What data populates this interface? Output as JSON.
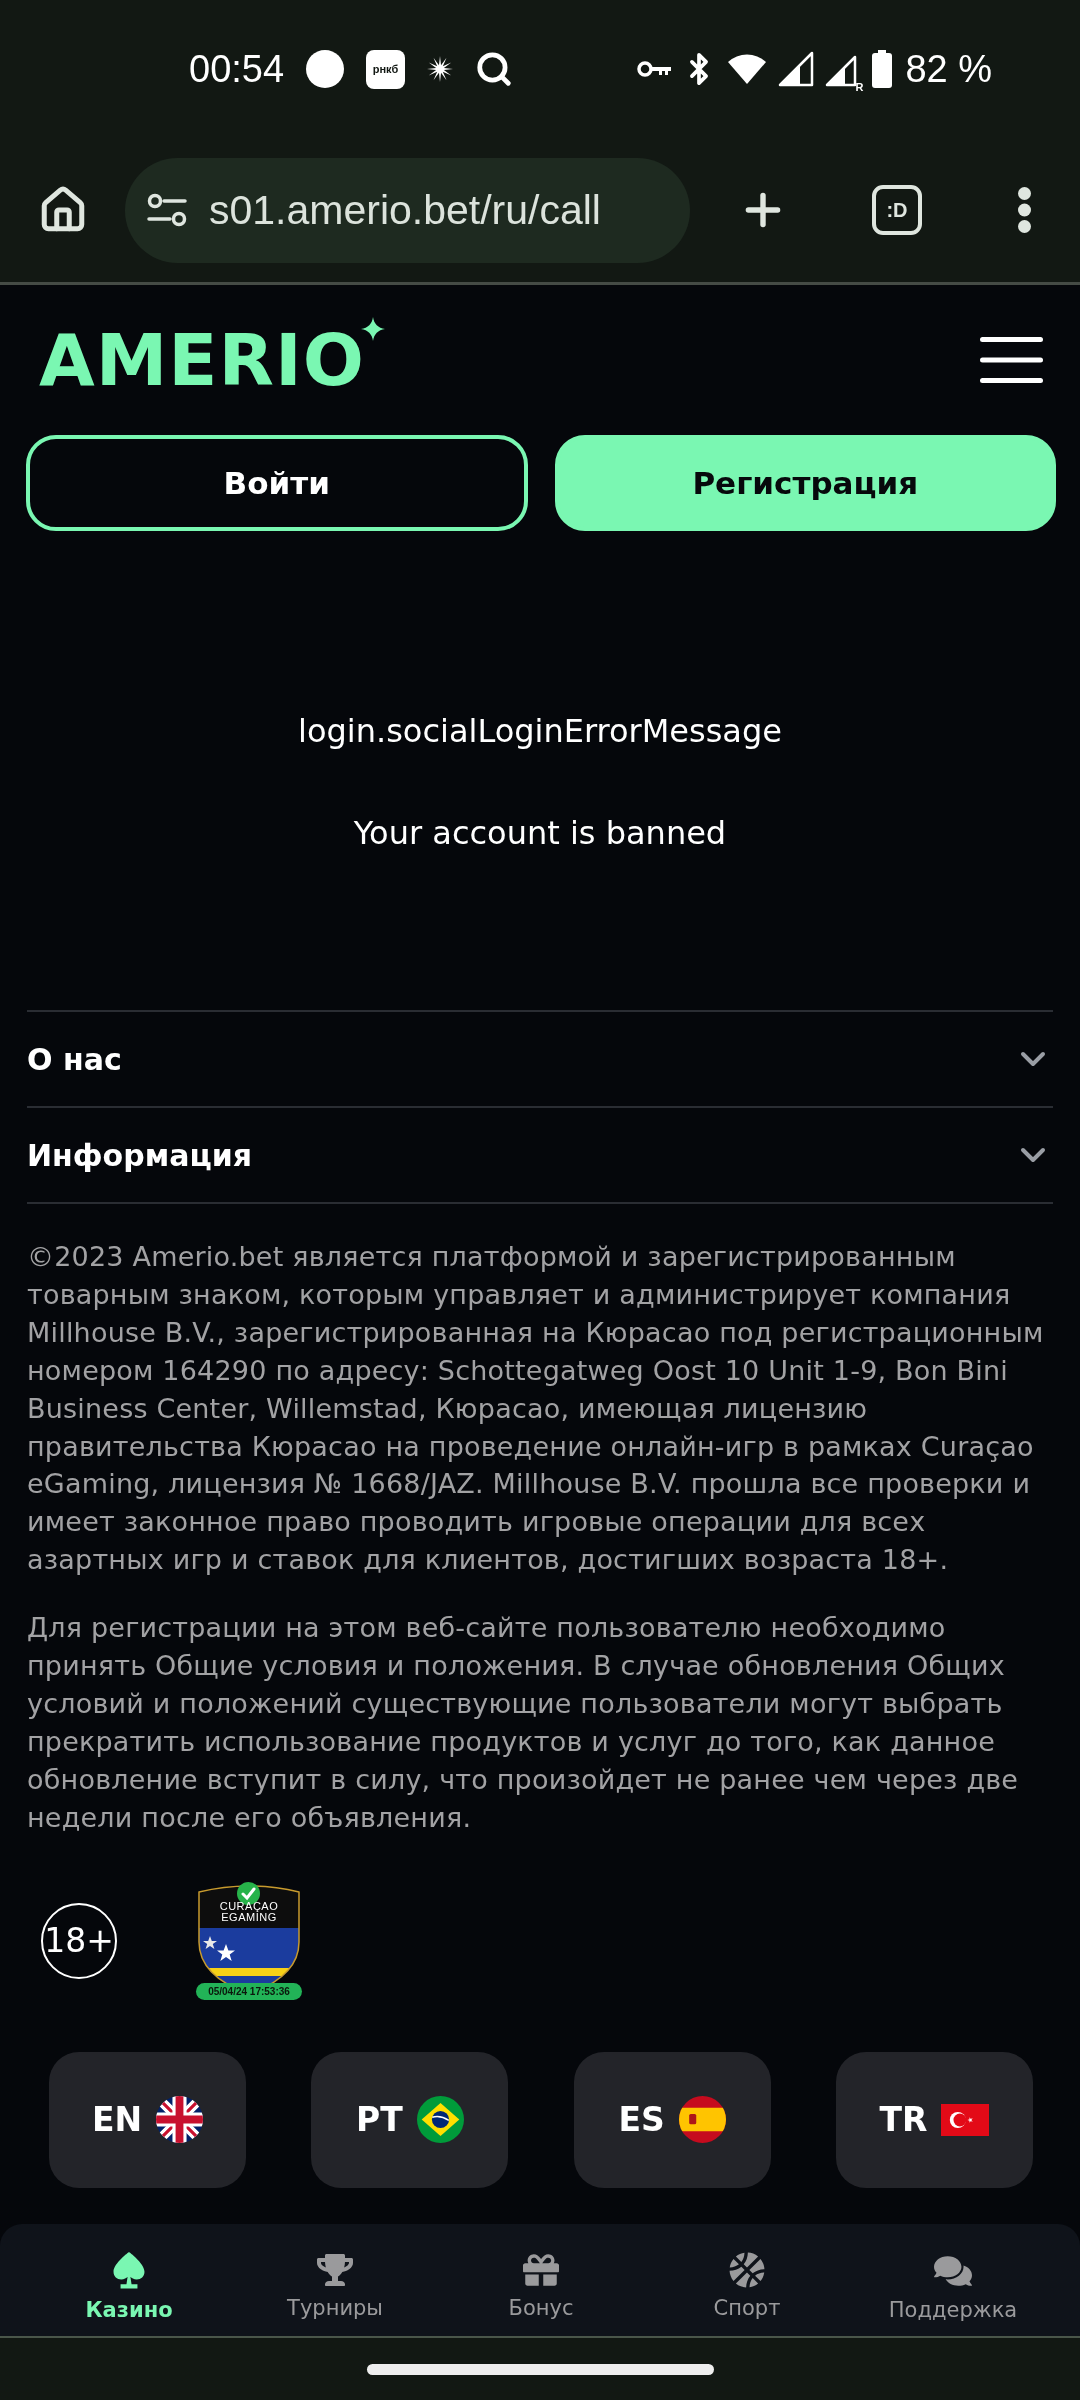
{
  "status_bar": {
    "time": "00:54",
    "app_badge": "рнкб",
    "roaming": "R",
    "battery": "82 %"
  },
  "browser": {
    "url": "s01.amerio.bet/ru/call",
    "tab_switcher": ":D"
  },
  "header": {
    "logo": "AMERIO"
  },
  "auth_buttons": [
    {
      "label": "Войти",
      "kind": "outline"
    },
    {
      "label": "Регистрация",
      "kind": "filled"
    }
  ],
  "messages": [
    "login.socialLoginErrorMessage",
    "Your account is banned"
  ],
  "accordion": [
    {
      "title": "О нас",
      "expanded": false
    },
    {
      "title": "Информация",
      "expanded": false
    }
  ],
  "legal_text": [
    "©2023 Amerio.bet является платформой и зарегистрированным товарным знаком, которым управляет и администрирует компания Millhouse B.V., зарегистрированная на Кюрасао под регистрационным номером 164290 по адресу: Schottegatweg Oost 10 Unit 1-9, Bon Bini Business Center, Willemstad, Кюрасао, имеющая лицензию правительства Кюрасао на проведение онлайн-игр в рамках Curaçao eGaming, лицензия № 1668/JAZ. Millhouse B.V. прошла все проверки и имеет законное право проводить игровые операции для всех азартных игр и ставок для клиентов, достигших возраста 18+.",
    "Для регистрации на этом веб-сайте пользователю необходимо принять Общие условия и положения. В случае обновления Общих условий и положений существующие пользователи могут выбрать прекратить использование продуктов и услуг до того, как данное обновление вступит в силу, что произойдет не ранее чем через две недели после его объявления."
  ],
  "badges": {
    "age": "18+",
    "license_seal": {
      "title_lines": [
        "CURAÇAO",
        "EGAMING"
      ],
      "timestamp": "05/04/24 17:53:36"
    }
  },
  "languages": [
    "EN",
    "PT",
    "ES",
    "TR"
  ],
  "bottom_nav": [
    {
      "label": "Казино",
      "selected": true
    },
    {
      "label": "Турниры",
      "selected": false
    },
    {
      "label": "Бонус",
      "selected": false
    },
    {
      "label": "Спорт",
      "selected": false
    },
    {
      "label": "Поддержка",
      "selected": false
    }
  ]
}
